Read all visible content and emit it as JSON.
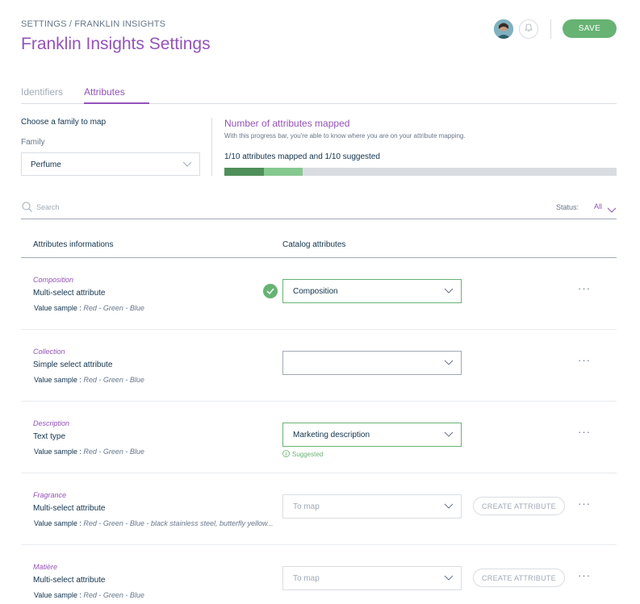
{
  "header": {
    "breadcrumb": "SETTINGS / FRANKLIN INSIGHTS",
    "title": "Franklin Insights Settings",
    "save_label": "SAVE",
    "bell_icon": "bell-icon",
    "colors": {
      "brand": "#9452ba",
      "success": "#67b373"
    }
  },
  "tabs": [
    {
      "label": "Identifiers",
      "active": false
    },
    {
      "label": "Attributes",
      "active": true
    }
  ],
  "family": {
    "title": "Choose a family to map",
    "label": "Family",
    "value": "Perfume"
  },
  "progress": {
    "title": "Number of attributes mapped",
    "help": "With this progress bar, you're able to know where you are on your attribute mapping.",
    "summary": "1/10 attributes mapped and 1/10 suggested",
    "mapped_fraction": 0.1,
    "suggested_fraction": 0.1
  },
  "filters": {
    "search_placeholder": "Search",
    "status_label": "Status:",
    "status_value": "All"
  },
  "table": {
    "headers": {
      "info": "Attributes informations",
      "catalog": "Catalog attributes"
    },
    "sample_prefix": "Value sample :",
    "create_label": "CREATE ATTRIBUTE",
    "rows": [
      {
        "name": "Composition",
        "type": "Multi-select attribute",
        "sample": "Red - Green - Blue",
        "catalog": "Composition",
        "state": "mapped"
      },
      {
        "name": "Collection",
        "type": "Simple select attribute",
        "sample": "Red - Green - Blue",
        "catalog": "",
        "state": "empty"
      },
      {
        "name": "Description",
        "type": "Text type",
        "sample": "Red - Green - Blue",
        "catalog": "Marketing description",
        "state": "suggested",
        "suggested_label": "Suggested"
      },
      {
        "name": "Fragrance",
        "type": "Multi-select attribute",
        "sample": "Red - Green - Blue - black stainless steel, butterfly yellow...",
        "catalog": "To map",
        "state": "pending"
      },
      {
        "name": "Matière",
        "type": "Multi-select attribute",
        "sample": "Red - Green - Blue",
        "catalog": "To map",
        "state": "pending"
      }
    ]
  }
}
